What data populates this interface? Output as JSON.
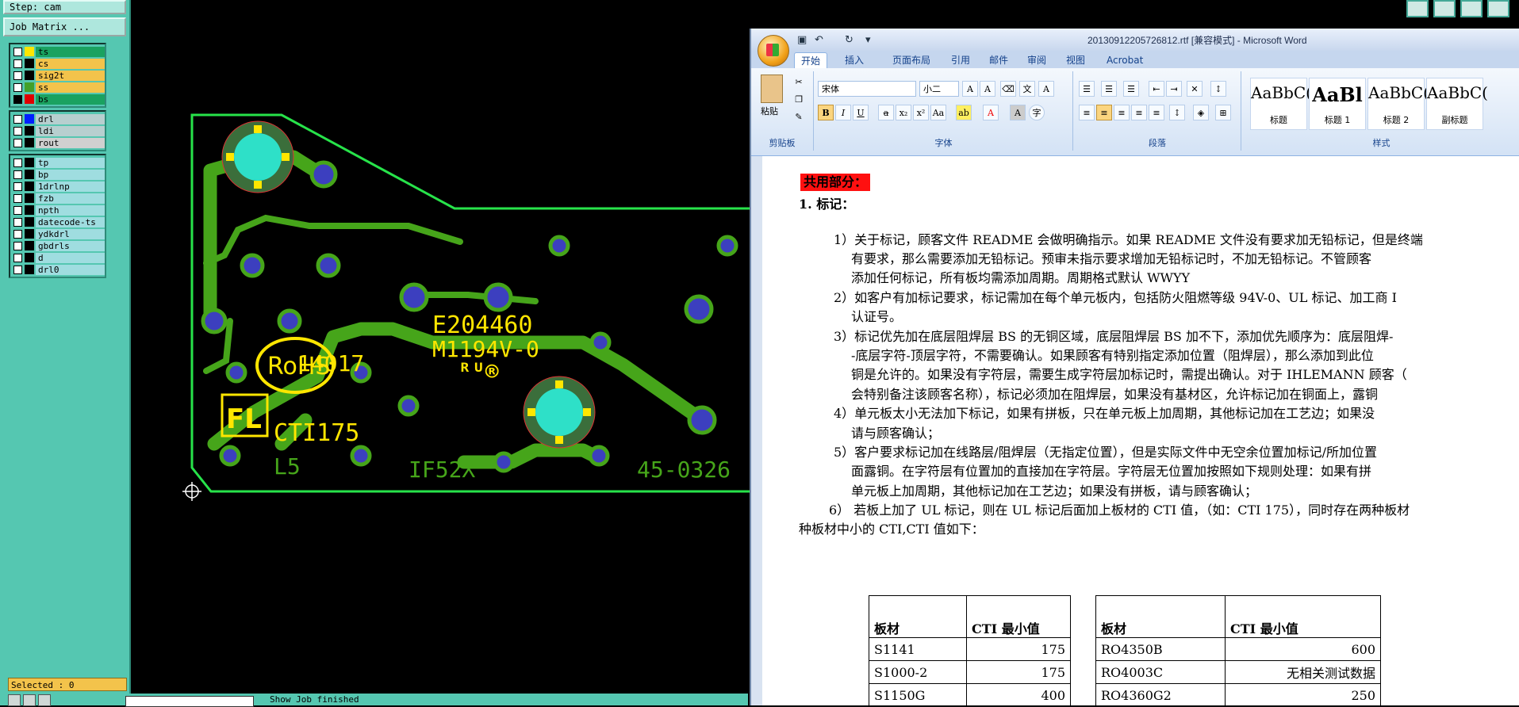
{
  "cam": {
    "step": "Step: cam",
    "job_matrix": "Job Matrix ...",
    "layer_groups": [
      [
        {
          "name": "ts",
          "swatch": "#ffe600",
          "bg": "#1aa260",
          "on": false
        },
        {
          "name": "cs",
          "swatch": "#000000",
          "bg": "#f3c34b",
          "on": false
        },
        {
          "name": "sig2t",
          "swatch": "#000000",
          "bg": "#f3c34b",
          "on": false
        },
        {
          "name": "ss",
          "swatch": "#43a02a",
          "bg": "#f3c34b",
          "on": false
        },
        {
          "name": "bs",
          "swatch": "#e00000",
          "bg": "#1aa260",
          "on": true
        }
      ],
      [
        {
          "name": "drl",
          "swatch": "#0020ff",
          "bg": "#b7cfcf",
          "on": false
        },
        {
          "name": "ldi",
          "swatch": "#000000",
          "bg": "#b7cfcf",
          "on": false
        },
        {
          "name": "rout",
          "swatch": "#000000",
          "bg": "#d0d0d0",
          "on": false
        }
      ],
      [
        {
          "name": "tp",
          "swatch": "#000000",
          "bg": "#9fdde0",
          "on": false
        },
        {
          "name": "bp",
          "swatch": "#000000",
          "bg": "#9fdde0",
          "on": false
        },
        {
          "name": "1drlnp",
          "swatch": "#000000",
          "bg": "#9fdde0",
          "on": false
        },
        {
          "name": "fzb",
          "swatch": "#000000",
          "bg": "#9fdde0",
          "on": false
        },
        {
          "name": "npth",
          "swatch": "#000000",
          "bg": "#9fdde0",
          "on": false
        },
        {
          "name": "datecode-ts",
          "swatch": "#000000",
          "bg": "#9fdde0",
          "on": false
        },
        {
          "name": "ydkdrl",
          "swatch": "#000000",
          "bg": "#9fdde0",
          "on": false
        },
        {
          "name": "gbdrls",
          "swatch": "#000000",
          "bg": "#9fdde0",
          "on": false
        },
        {
          "name": "d",
          "swatch": "#000000",
          "bg": "#9fdde0",
          "on": false
        },
        {
          "name": "drl0",
          "swatch": "#000000",
          "bg": "#9fdde0",
          "on": false
        }
      ]
    ],
    "selected": "Selected : 0",
    "status_message": "Show Job finished",
    "board_text": {
      "ul_number": "E204460",
      "material": "M1194V-0",
      "ul_mark": "ᴿᵁ®",
      "rohs": "RoHS",
      "fl": "FL",
      "date": "14017",
      "cti": "CTI175",
      "mirror1": "L5",
      "mirror2": "IF52X",
      "mirror3": "45-0326"
    }
  },
  "word": {
    "title": "20130912205726812.rtf [兼容模式] - Microsoft Word",
    "tabs": [
      "开始",
      "插入",
      "页面布局",
      "引用",
      "邮件",
      "审阅",
      "视图",
      "Acrobat"
    ],
    "clipboard": {
      "paste": "粘贴",
      "group": "剪贴板"
    },
    "font": {
      "name": "宋体",
      "size": "小二",
      "group": "字体"
    },
    "paragraph_group": "段落",
    "styles": {
      "group": "样式",
      "items": [
        {
          "sample": "AaBbC(",
          "name": "标题"
        },
        {
          "sample": "AaBl",
          "name": "标题 1"
        },
        {
          "sample": "AaBbC(",
          "name": "标题 2"
        },
        {
          "sample": "AaBbC(",
          "name": "副标题"
        }
      ]
    },
    "doc": {
      "heading": "共用部分：",
      "item1": "1.    标记：",
      "lines": [
        "1）关于标记，顾客文件 README 会做明确指示。如果 README 文件没有要求加无铅标记，但是终端",
        "有要求，那么需要添加无铅标记。预审未指示要求增加无铅标记时，不加无铅标记。不管顾客",
        "添加任何标记，所有板均需添加周期。周期格式默认 WWYY",
        "2）如客户有加标记要求，标记需加在每个单元板内，包括防火阻燃等级 94V-0、UL 标记、加工商 I",
        "认证号。",
        "3）标记优先加在底层阻焊层 BS 的无铜区域，底层阻焊层 BS 加不下，添加优先顺序为：底层阻焊-",
        "-底层字符-顶层字符，不需要确认。如果顾客有特别指定添加位置（阻焊层），那么添加到此位",
        "铜是允许的。如果没有字符层，需要生成字符层加标记时，需提出确认。对于 IHLEMANN 顾客（",
        "会特别备注该顾客名称），标记必须加在阻焊层，如果没有基材区，允许标记加在铜面上，露铜",
        "4）单元板太小无法加下标记，如果有拼板，只在单元板上加周期，其他标记加在工艺边；如果没",
        "请与顾客确认；",
        "5）客户要求标记加在线路层/阻焊层（无指定位置），但是实际文件中无空余位置加标记/所加位置",
        "面露铜。在字符层有位置加的直接加在字符层。字符层无位置加按照如下规则处理：如果有拼",
        "单元板上加周期，其他标记加在工艺边；如果没有拼板，请与顾客确认；",
        "6）   若板上加了 UL 标记，则在 UL 标记后面加上板材的 CTI 值，（如：CTI 175），同时存在两种板材",
        "种板材中小的 CTI,CTI 值如下："
      ],
      "table1": {
        "header": [
          "板材",
          "CTI 最小值"
        ],
        "rows": [
          [
            "S1141",
            "175"
          ],
          [
            "S1000-2",
            "175"
          ],
          [
            "S1150G",
            "400"
          ]
        ]
      },
      "table2": {
        "header": [
          "板材",
          "CTI 最小值"
        ],
        "rows": [
          [
            "RO4350B",
            "600"
          ],
          [
            "RO4003C",
            "无相关测试数据"
          ],
          [
            "RO4360G2",
            "250"
          ]
        ]
      }
    }
  }
}
